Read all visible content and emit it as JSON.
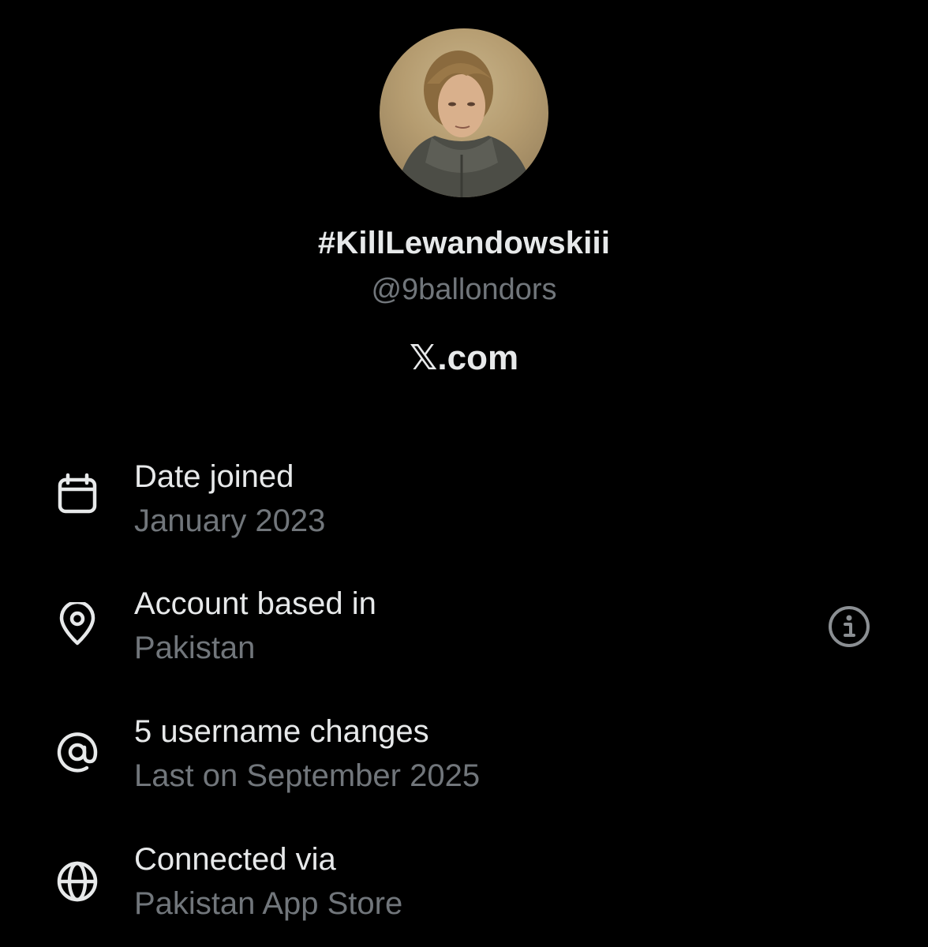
{
  "profile": {
    "display_name": "#KillLewandowskiii",
    "handle": "@9ballondors",
    "domain_label": "𝕏.com"
  },
  "about_rows": [
    {
      "icon": "calendar-icon",
      "title": "Date joined",
      "value": "January 2023"
    },
    {
      "icon": "location-pin-icon",
      "title": "Account based in",
      "value": "Pakistan"
    },
    {
      "icon": "at-sign-icon",
      "title": "5 username changes",
      "value": "Last on September 2025"
    },
    {
      "icon": "globe-icon",
      "title": "Connected via",
      "value": "Pakistan App Store"
    }
  ],
  "colors": {
    "background": "#000000",
    "primary_text": "#e7e9ea",
    "secondary_text": "#71767b"
  }
}
